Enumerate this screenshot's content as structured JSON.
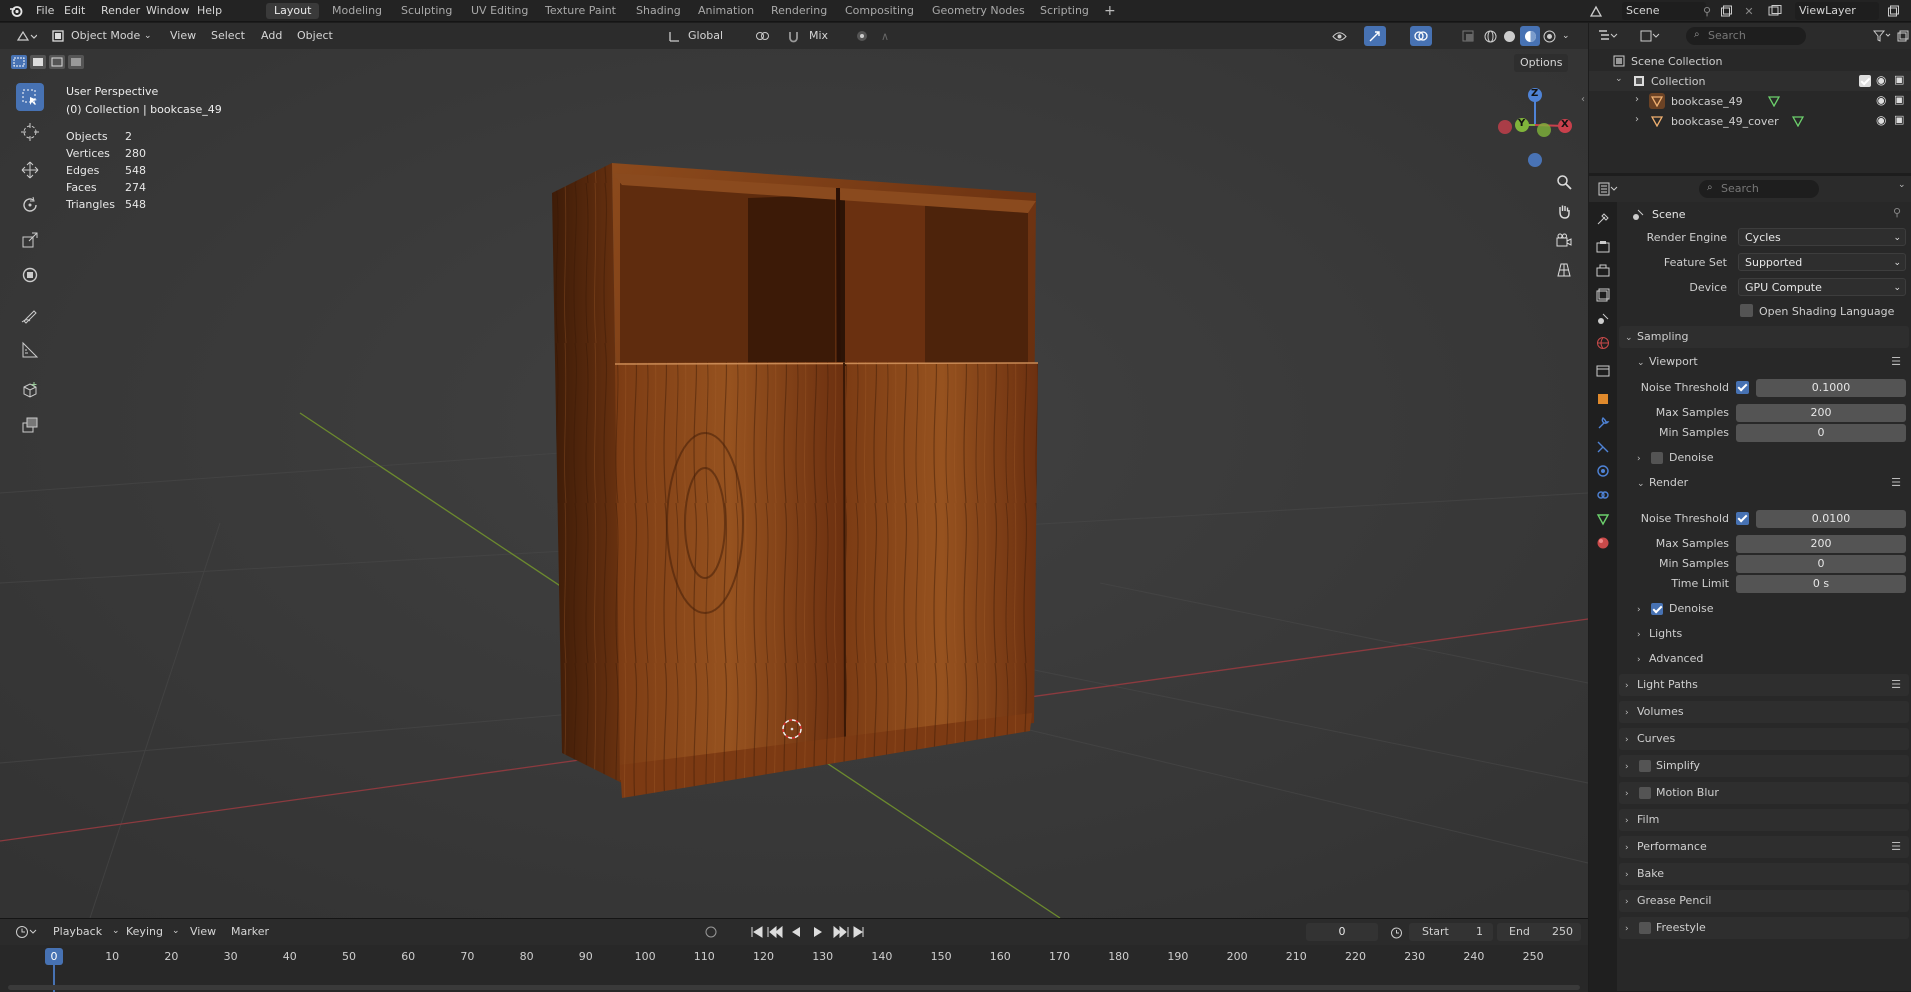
{
  "menu": {
    "file": "File",
    "edit": "Edit",
    "render": "Render",
    "window": "Window",
    "help": "Help"
  },
  "workspaces": [
    "Layout",
    "Modeling",
    "Sculpting",
    "UV Editing",
    "Texture Paint",
    "Shading",
    "Animation",
    "Rendering",
    "Compositing",
    "Geometry Nodes",
    "Scripting"
  ],
  "active_workspace": "Layout",
  "scene_name": "Scene",
  "view_layer": "ViewLayer",
  "viewport_header": {
    "mode": "Object Mode",
    "view": "View",
    "select": "Select",
    "add": "Add",
    "object": "Object",
    "orientation": "Global",
    "snap_mode": "Mix",
    "options": "Options"
  },
  "viewport_overlay": {
    "perspective": "User Perspective",
    "collection_info": "(0) Collection | bookcase_49"
  },
  "stats": [
    {
      "label": "Objects",
      "value": "2"
    },
    {
      "label": "Vertices",
      "value": "280"
    },
    {
      "label": "Edges",
      "value": "548"
    },
    {
      "label": "Faces",
      "value": "274"
    },
    {
      "label": "Triangles",
      "value": "548"
    }
  ],
  "gizmo": {
    "x": "X",
    "y": "Y",
    "z": "Z"
  },
  "outliner": {
    "search_placeholder": "Search",
    "root": "Scene Collection",
    "collection": "Collection",
    "objects": [
      "bookcase_49",
      "bookcase_49_cover"
    ]
  },
  "properties": {
    "search_placeholder": "Search",
    "context": "Scene",
    "render_engine_label": "Render Engine",
    "render_engine": "Cycles",
    "feature_set_label": "Feature Set",
    "feature_set": "Supported",
    "device_label": "Device",
    "device": "GPU Compute",
    "osl_label": "Open Shading Language",
    "sampling": "Sampling",
    "viewport": "Viewport",
    "noise_threshold_label": "Noise Threshold",
    "viewport_noise_threshold": "0.1000",
    "max_samples_label": "Max Samples",
    "viewport_max_samples": "200",
    "min_samples_label": "Min Samples",
    "viewport_min_samples": "0",
    "denoise_label": "Denoise",
    "render": "Render",
    "render_noise_threshold": "0.0100",
    "render_max_samples": "200",
    "render_min_samples": "0",
    "time_limit_label": "Time Limit",
    "time_limit": "0 s",
    "lights": "Lights",
    "advanced": "Advanced",
    "sections": [
      "Light Paths",
      "Volumes",
      "Curves",
      "Simplify",
      "Motion Blur",
      "Film",
      "Performance",
      "Bake",
      "Grease Pencil",
      "Freestyle"
    ]
  },
  "timeline": {
    "playback": "Playback",
    "keying": "Keying",
    "view": "View",
    "marker": "Marker",
    "current_frame": "0",
    "start_label": "Start",
    "start": "1",
    "end_label": "End",
    "end": "250",
    "playhead_frame": "0",
    "ticks": [
      "10",
      "20",
      "30",
      "40",
      "50",
      "60",
      "70",
      "80",
      "90",
      "100",
      "110",
      "120",
      "130",
      "140",
      "150",
      "160",
      "170",
      "180",
      "190",
      "200",
      "210",
      "220",
      "230",
      "240",
      "250"
    ]
  },
  "colors": {
    "accent": "#4772b3",
    "x_axis": "#c8404c",
    "y_axis": "#80b43b",
    "z_axis": "#4f83d6",
    "wood": "#7a3d16"
  }
}
